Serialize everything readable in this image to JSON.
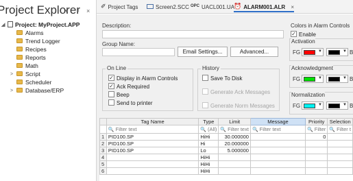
{
  "explorer": {
    "title": "Project Explorer",
    "buttons": [
      "▾",
      "⁴",
      "×"
    ],
    "project": "Project: MyProject.APP",
    "items": [
      {
        "label": "Alarms",
        "expandable": false
      },
      {
        "label": "Trend Logger",
        "expandable": false
      },
      {
        "label": "Recipes",
        "expandable": false
      },
      {
        "label": "Reports",
        "expandable": false
      },
      {
        "label": "Math",
        "expandable": false
      },
      {
        "label": "Script",
        "expandable": true
      },
      {
        "label": "Scheduler",
        "expandable": false
      },
      {
        "label": "Database/ERP",
        "expandable": true
      }
    ]
  },
  "tabs": [
    {
      "label": "Project Tags",
      "icon": "pencil-icon"
    },
    {
      "label": "Screen2.SCC",
      "icon": "screen-icon"
    },
    {
      "label": "UACL001.UA",
      "icon": "opc-icon"
    },
    {
      "label": "ALARM001.ALR",
      "icon": "alarm-clock-icon",
      "active": true,
      "close": "×"
    }
  ],
  "config": {
    "description_label": "Description:",
    "description_value": "",
    "group_name_label": "Group Name:",
    "group_name_value": "",
    "email_settings": "Email Settings...",
    "advanced": "Advanced...",
    "online": {
      "title": "On Line",
      "options": [
        {
          "label": "Display in Alarm Controls",
          "checked": true
        },
        {
          "label": "Ack Required",
          "checked": true
        },
        {
          "label": "Beep",
          "checked": false
        },
        {
          "label": "Send to printer",
          "checked": false
        }
      ]
    },
    "history": {
      "title": "History",
      "save_to_disk": "Save To Disk",
      "generate_ack": "Generate Ack Messages",
      "generate_norm": "Generate Norm Messages"
    },
    "colors": {
      "title": "Colors in Alarm Controls",
      "enable": "Enable",
      "fg": "FG",
      "bg": "BG",
      "sections": [
        {
          "title": "Activation",
          "fg_color": "#ff0000",
          "bg_color": "#000000"
        },
        {
          "title": "Acknowledgment",
          "fg_color": "#00e000",
          "bg_color": "#000000"
        },
        {
          "title": "Normalization",
          "fg_color": "#00f0f0",
          "bg_color": "#000000"
        }
      ]
    }
  },
  "grid": {
    "columns": [
      "",
      "Tag Name",
      "Type",
      "Limit",
      "Message",
      "Priority",
      "Selection"
    ],
    "filters": [
      "",
      "Filter text",
      "(All)",
      "Filter text",
      "Filter text",
      "Filter",
      "Filter t"
    ],
    "rows": [
      {
        "n": "1",
        "tag": "PID100.SP",
        "type": "HiHi",
        "limit": "30.000000",
        "message": "",
        "priority": "0",
        "selection": ""
      },
      {
        "n": "2",
        "tag": "PID100.SP",
        "type": "Hi",
        "limit": "20.000000",
        "message": "",
        "priority": "",
        "selection": ""
      },
      {
        "n": "3",
        "tag": "PID100.SP",
        "type": "Lo",
        "limit": "5.000000",
        "message": "",
        "priority": "",
        "selection": ""
      },
      {
        "n": "4",
        "tag": "",
        "type": "HiHi",
        "limit": "",
        "message": "",
        "priority": "",
        "selection": ""
      },
      {
        "n": "5",
        "tag": "",
        "type": "HiHi",
        "limit": "",
        "message": "",
        "priority": "",
        "selection": ""
      },
      {
        "n": "6",
        "tag": "",
        "type": "HiHi",
        "limit": "",
        "message": "",
        "priority": "",
        "selection": ""
      }
    ]
  }
}
